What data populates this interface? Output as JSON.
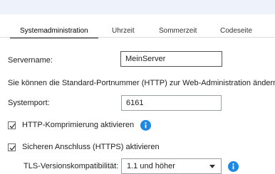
{
  "tabs": [
    {
      "label": "Systemadministration",
      "active": true
    },
    {
      "label": "Uhrzeit",
      "active": false
    },
    {
      "label": "Sommerzeit",
      "active": false
    },
    {
      "label": "Codeseite",
      "active": false
    }
  ],
  "server_name": {
    "label": "Servername:",
    "value": "MeinServer"
  },
  "port_info_text": "Sie können die Standard-Portnummer (HTTP) zur Web-Administration ändern.",
  "system_port": {
    "label": "Systemport:",
    "value": "6161"
  },
  "http_compression": {
    "label": "HTTP-Komprimierung aktivieren",
    "checked": true
  },
  "https": {
    "label": "Sicheren Anschluss (HTTPS) aktivieren",
    "checked": true
  },
  "tls": {
    "label": "TLS-Versionskompatibilität:",
    "selected": "1.1 und höher"
  },
  "colors": {
    "info_icon": "#1e88e5",
    "top_band": "#eef3fb"
  },
  "icons": {
    "info": "info-circle-icon",
    "check": "check-icon",
    "dropdown": "chevron-down-icon"
  }
}
